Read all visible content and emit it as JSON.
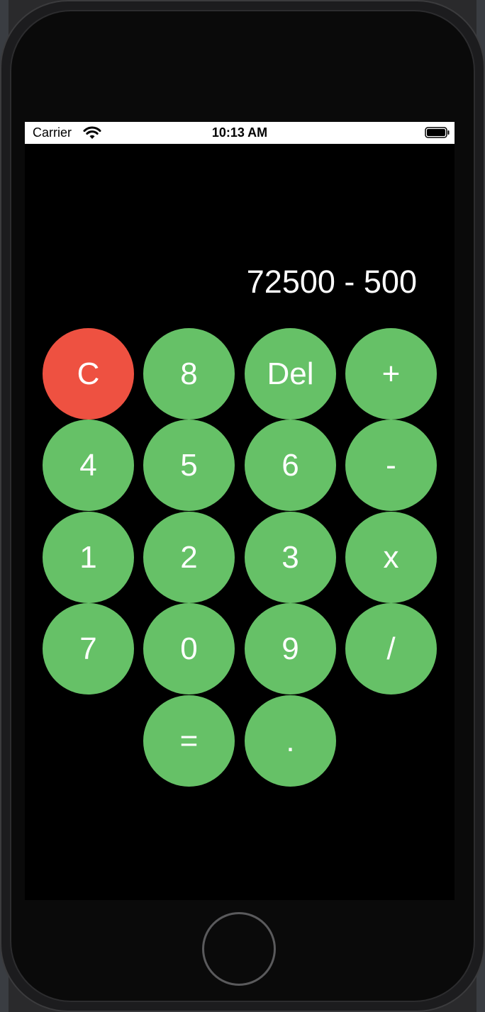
{
  "status_bar": {
    "carrier": "Carrier",
    "time": "10:13 AM"
  },
  "display": {
    "expression": "72500 - 500"
  },
  "keys": [
    {
      "label": "C"
    },
    {
      "label": "8"
    },
    {
      "label": "Del"
    },
    {
      "label": "+"
    },
    {
      "label": "4"
    },
    {
      "label": "5"
    },
    {
      "label": "6"
    },
    {
      "label": "-"
    },
    {
      "label": "1"
    },
    {
      "label": "2"
    },
    {
      "label": "3"
    },
    {
      "label": "x"
    },
    {
      "label": "7"
    },
    {
      "label": "0"
    },
    {
      "label": "9"
    },
    {
      "label": "/"
    },
    {
      "label": "="
    },
    {
      "label": "."
    }
  ],
  "colors": {
    "key_green": "#66c167",
    "key_red": "#ee5141",
    "screen_background": "#000000"
  }
}
